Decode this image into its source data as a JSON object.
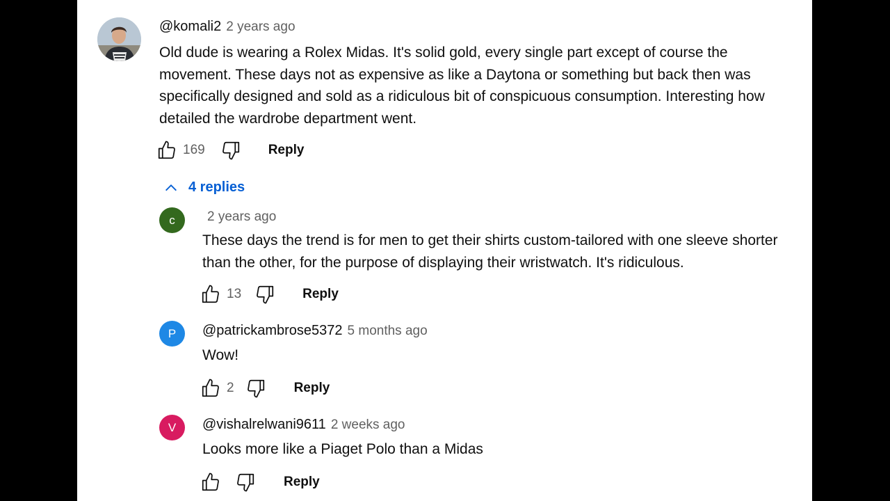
{
  "colors": {
    "link_blue": "#065fd4",
    "secondary_text": "#606060",
    "avatar_c": "#33691e",
    "avatar_p": "#1e88e5",
    "avatar_v": "#d81b60"
  },
  "comment": {
    "handle": "@komali2",
    "time": "2 years ago",
    "text": "Old dude is wearing a Rolex Midas. It's solid gold, every single part except of course the movement. These days not as expensive as like a Daytona or something but back then was specifically designed and sold as a ridiculous bit of conspicuous consumption. Interesting how detailed the wardrobe department went.",
    "likes": "169",
    "reply_label": "Reply",
    "replies_toggle": "4 replies"
  },
  "replies": [
    {
      "avatar_letter": "c",
      "handle": "",
      "time": "2 years ago",
      "text": "These days the trend is for men to get their shirts custom-tailored with one sleeve shorter than the other, for the purpose of displaying their wristwatch. It's ridiculous.",
      "likes": "13",
      "reply_label": "Reply"
    },
    {
      "avatar_letter": "P",
      "handle": "@patrickambrose5372",
      "time": "5 months ago",
      "text": "Wow!",
      "likes": "2",
      "reply_label": "Reply"
    },
    {
      "avatar_letter": "V",
      "handle": "@vishalrelwani9611",
      "time": "2 weeks ago",
      "text": "Looks more like a Piaget Polo than a Midas",
      "likes": "",
      "reply_label": "Reply"
    }
  ]
}
